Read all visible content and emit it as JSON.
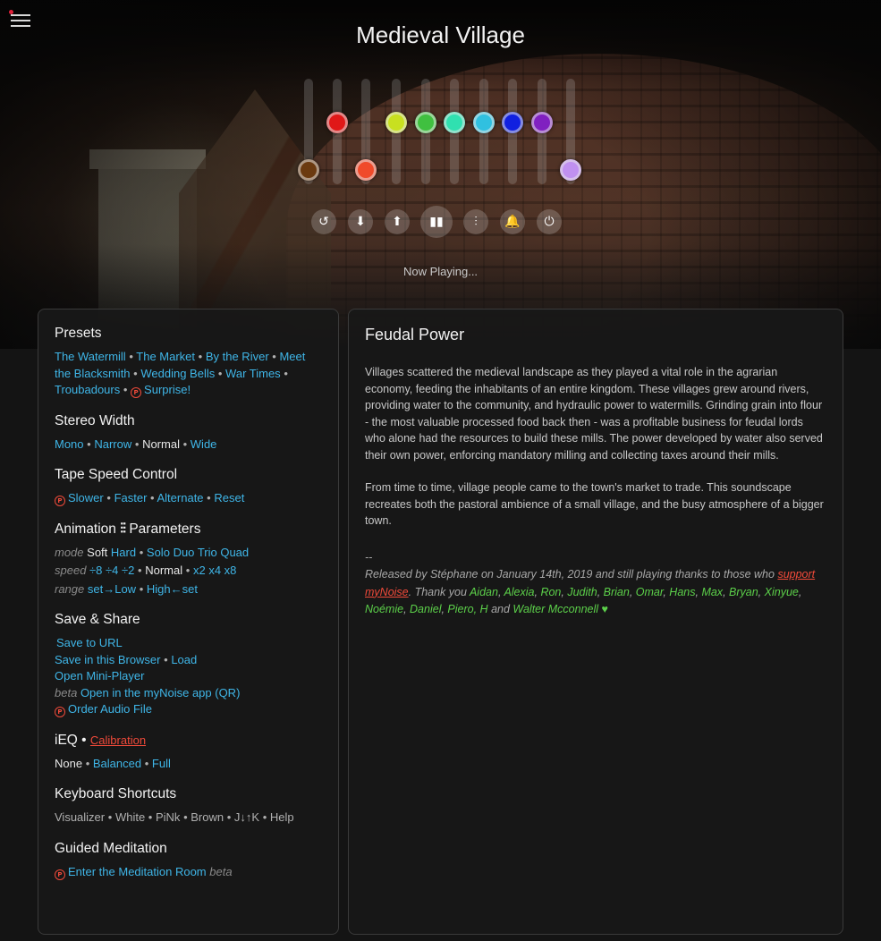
{
  "app": {
    "title": "Medieval Village",
    "now_playing": "Now Playing..."
  },
  "sliders": [
    {
      "color": "#6b3a10",
      "level": 0.1
    },
    {
      "color": "#e01818",
      "level": 0.55
    },
    {
      "color": "#f04a2a",
      "level": 0.1
    },
    {
      "color": "#c8e020",
      "level": 0.55
    },
    {
      "color": "#40c040",
      "level": 0.55
    },
    {
      "color": "#30e0b0",
      "level": 0.55
    },
    {
      "color": "#30c0e0",
      "level": 0.55
    },
    {
      "color": "#1020e0",
      "level": 0.55
    },
    {
      "color": "#8020c0",
      "level": 0.55
    },
    {
      "color": "#c090f0",
      "level": 0.1
    }
  ],
  "controls": {
    "undo_icon": "↺",
    "down_icon": "⬇",
    "up_icon": "⬆",
    "play_icon": "▮▮",
    "mixer_icon": "⫶",
    "bell_icon": "🔔",
    "timer_icon": "⏻"
  },
  "left": {
    "presets": {
      "title": "Presets",
      "items": [
        "The Watermill",
        "The Market",
        "By the River",
        "Meet the Blacksmith",
        "Wedding Bells",
        "War Times",
        "Troubadours",
        "Surprise!"
      ]
    },
    "stereo": {
      "title": "Stereo Width",
      "mono": "Mono",
      "narrow": "Narrow",
      "normal": "Normal",
      "wide": "Wide"
    },
    "tape": {
      "title": "Tape Speed Control",
      "slower": "Slower",
      "faster": "Faster",
      "alternate": "Alternate",
      "reset": "Reset"
    },
    "animation": {
      "title_a": "Animation",
      "title_b": "Parameters",
      "mode_label": "mode",
      "mode_soft": "Soft",
      "mode_hard": "Hard",
      "mode_solo": "Solo",
      "mode_duo": "Duo",
      "mode_trio": "Trio",
      "mode_quad": "Quad",
      "speed_label": "speed",
      "speed_d8": "÷8",
      "speed_d4": "÷4",
      "speed_d2": "÷2",
      "speed_normal": "Normal",
      "speed_x2": "x2",
      "speed_x4": "x4",
      "speed_x8": "x8",
      "range_label": "range",
      "range_low": "set→Low",
      "range_high": "High←set"
    },
    "save": {
      "title": "Save & Share",
      "url": "Save to URL",
      "browser": "Save in this Browser",
      "load": "Load",
      "mini": "Open Mini-Player",
      "beta": "beta",
      "app": "Open in the myNoise app (QR)",
      "order": "Order Audio File"
    },
    "ieq": {
      "title": "iEQ",
      "calibration": "Calibration",
      "none": "None",
      "balanced": "Balanced",
      "full": "Full"
    },
    "keyboard": {
      "title": "Keyboard Shortcuts",
      "visualizer": "Visualizer",
      "white": "White",
      "pink": "PiNk",
      "brown": "Brown",
      "jk": "J↓↑K",
      "help": "Help"
    },
    "meditation": {
      "title": "Guided Meditation",
      "enter": "Enter the Meditation Room",
      "beta": "beta"
    }
  },
  "right": {
    "title": "Feudal Power",
    "para1": "Villages scattered the medieval landscape as they played a vital role in the agrarian economy, feeding the inhabitants of an entire kingdom. These villages grew around rivers, providing water to the community, and hydraulic power to watermills. Grinding grain into flour - the most valuable processed food back then - was a profitable business for feudal lords who alone had the resources to build these mills. The power developed by water also served their own power, enforcing mandatory milling and collecting taxes around their mills.",
    "para2": "From time to time, village people came to the town's market to trade. This soundscape recreates both the pastoral ambience of a small village, and the busy atmosphere of a bigger town.",
    "dash": "--",
    "released": "Released by Stéphane on January 14th, 2019 and still playing thanks to those who",
    "support": "support myNoise",
    "thank": ". Thank you",
    "names": [
      "Aidan",
      "Alexia",
      "Ron",
      "Judith",
      "Brian",
      "Omar",
      "Hans",
      "Max",
      "Bryan",
      "Xinyue",
      "Noémie",
      "Daniel",
      "Piero, H"
    ],
    "and": "and",
    "last": "Walter Mcconnell",
    "heart": "♥"
  }
}
